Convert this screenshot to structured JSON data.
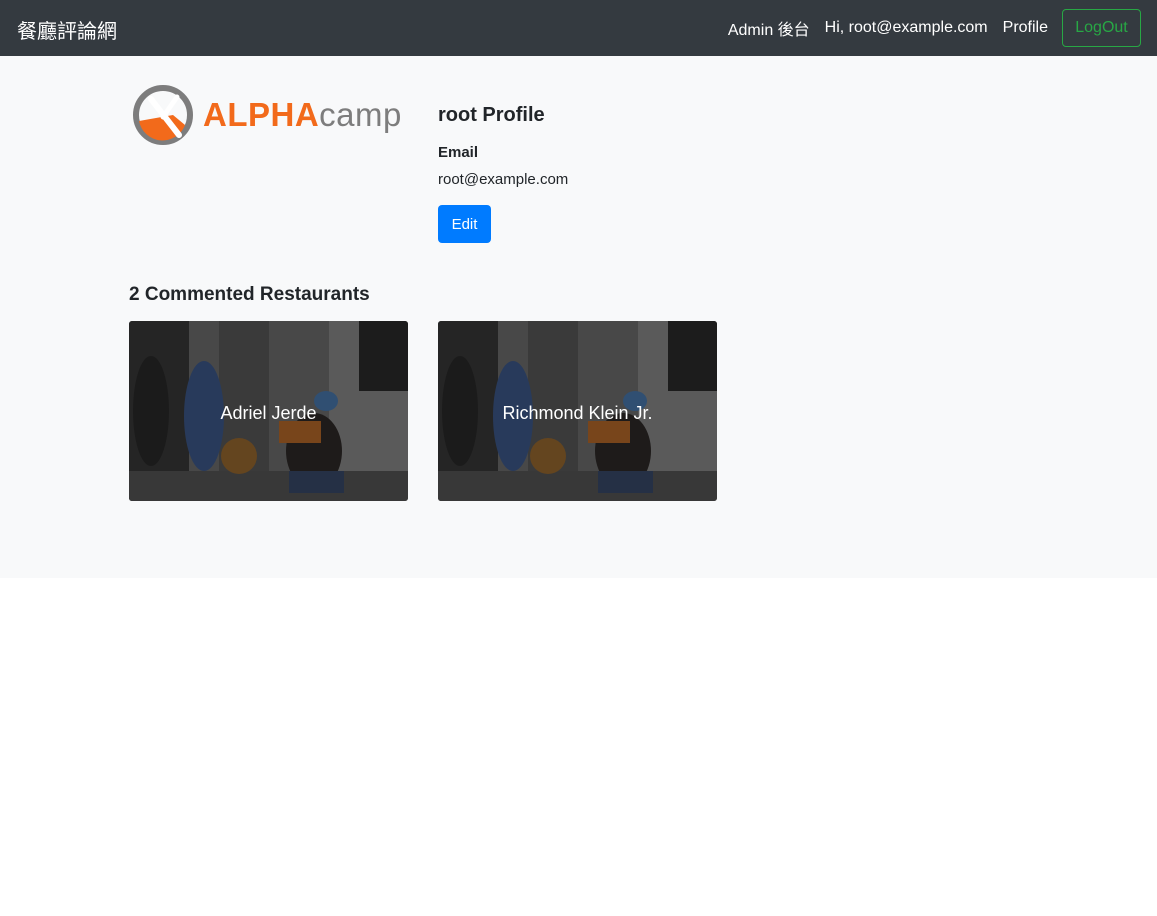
{
  "navbar": {
    "brand": "餐廳評論網",
    "links": [
      "Admin 後台",
      "Hi, root@example.com",
      "Profile"
    ],
    "logout_label": "LogOut"
  },
  "logo": {
    "alpha_text": "ALPHA",
    "camp_text": "camp",
    "brand_orange": "#f26a1b",
    "brand_gray": "#7d7d7d"
  },
  "profile": {
    "title": "root Profile",
    "email_label": "Email",
    "email_value": "root@example.com",
    "edit_label": "Edit"
  },
  "commented": {
    "title": "2 Commented Restaurants",
    "restaurants": [
      {
        "name": "Adriel Jerde"
      },
      {
        "name": "Richmond Klein Jr."
      }
    ]
  },
  "colors": {
    "navbar_bg": "#343a40",
    "logout_green": "#28a745",
    "primary_blue": "#007bff",
    "page_bg": "#f8f9fa"
  }
}
